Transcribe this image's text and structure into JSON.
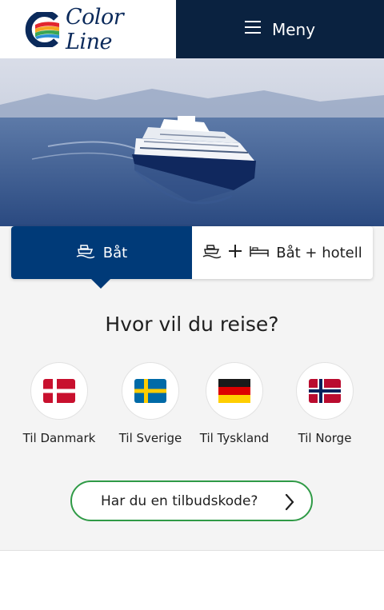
{
  "header": {
    "logo_text": "Color Line",
    "menu_label": "Meny",
    "colors": {
      "navy": "#0a2240",
      "logo_blue": "#0b2a5b"
    }
  },
  "tabs": [
    {
      "label": "Båt",
      "icon": "ship-icon",
      "selected": true
    },
    {
      "label": "Båt + hotell",
      "icon": "ship-plus-bed-icon",
      "selected": false
    }
  ],
  "search": {
    "question": "Hvor vil du reise?",
    "destinations": [
      {
        "label": "Til Danmark",
        "flag": "denmark-flag"
      },
      {
        "label": "Til Sverige",
        "flag": "sweden-flag"
      },
      {
        "label": "Til Tyskland",
        "flag": "germany-flag"
      },
      {
        "label": "Til Norge",
        "flag": "norway-flag"
      }
    ],
    "promo_label": "Har du en tilbudskode?"
  },
  "colors": {
    "accent_blue": "#003a78",
    "promo_green": "#2f9a46"
  }
}
